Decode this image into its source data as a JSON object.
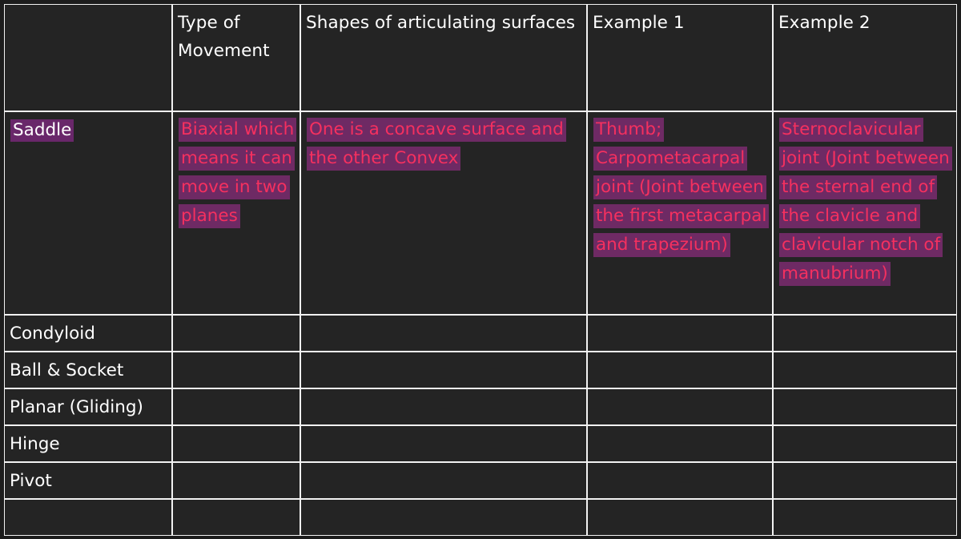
{
  "table": {
    "columns": [
      {
        "key": "joint_type",
        "label": ""
      },
      {
        "key": "movement",
        "label": "Type of Movement"
      },
      {
        "key": "shapes",
        "label": "Shapes of articulating surfaces"
      },
      {
        "key": "example1",
        "label": "Example 1"
      },
      {
        "key": "example2",
        "label": "Example 2"
      }
    ],
    "rows": [
      {
        "label": "Saddle",
        "highlighted": true,
        "movement": "Biaxial which means it can move in two planes",
        "shapes": "One is a concave surface and the other Convex",
        "example1": "Thumb; Carpometacarpal joint (Joint between the first metacarpal and trapezium)",
        "example2": "Sternoclavicular joint (Joint between the sternal end of the clavicle and clavicular notch of manubrium)"
      },
      {
        "label": "Condyloid",
        "highlighted": false,
        "movement": "",
        "shapes": "",
        "example1": "",
        "example2": ""
      },
      {
        "label": "Ball & Socket",
        "highlighted": false,
        "movement": "",
        "shapes": "",
        "example1": "",
        "example2": ""
      },
      {
        "label": "Planar (Gliding)",
        "highlighted": false,
        "movement": "",
        "shapes": "",
        "example1": "",
        "example2": ""
      },
      {
        "label": "Hinge",
        "highlighted": false,
        "movement": "",
        "shapes": "",
        "example1": "",
        "example2": ""
      },
      {
        "label": "Pivot",
        "highlighted": false,
        "movement": "",
        "shapes": "",
        "example1": "",
        "example2": ""
      },
      {
        "label": "",
        "highlighted": false,
        "movement": "",
        "shapes": "",
        "example1": "",
        "example2": ""
      }
    ]
  },
  "colors": {
    "background": "#1c1c1c",
    "cell_background": "#242424",
    "border": "#f2f2f2",
    "highlight_purple": "#6e2a64",
    "highlight_text_pink": "#f5305f",
    "text_white": "#ffffff"
  }
}
